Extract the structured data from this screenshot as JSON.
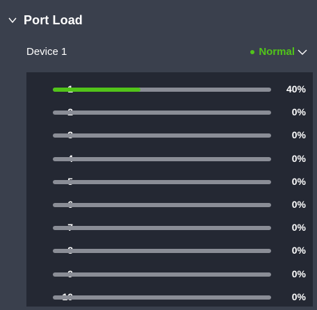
{
  "panel": {
    "title": "Port Load",
    "icons": {
      "collapse": "chevron-down-icon",
      "status_menu": "chevron-down-icon"
    }
  },
  "device": {
    "name": "Device 1",
    "status": "Normal",
    "status_color": "#52c41a"
  },
  "ports": [
    {
      "label": "1",
      "load_percent": 40,
      "text": "40%"
    },
    {
      "label": "2",
      "load_percent": 0,
      "text": "0%"
    },
    {
      "label": "3",
      "load_percent": 0,
      "text": "0%"
    },
    {
      "label": "4",
      "load_percent": 0,
      "text": "0%"
    },
    {
      "label": "5",
      "load_percent": 0,
      "text": "0%"
    },
    {
      "label": "6",
      "load_percent": 0,
      "text": "0%"
    },
    {
      "label": "7",
      "load_percent": 0,
      "text": "0%"
    },
    {
      "label": "8",
      "load_percent": 0,
      "text": "0%"
    },
    {
      "label": "9",
      "load_percent": 0,
      "text": "0%"
    },
    {
      "label": "10",
      "load_percent": 0,
      "text": "0%"
    }
  ],
  "colors": {
    "background": "#3a404d",
    "list_background": "#242833",
    "track": "#8a8d96",
    "fill": "#52c41a"
  }
}
